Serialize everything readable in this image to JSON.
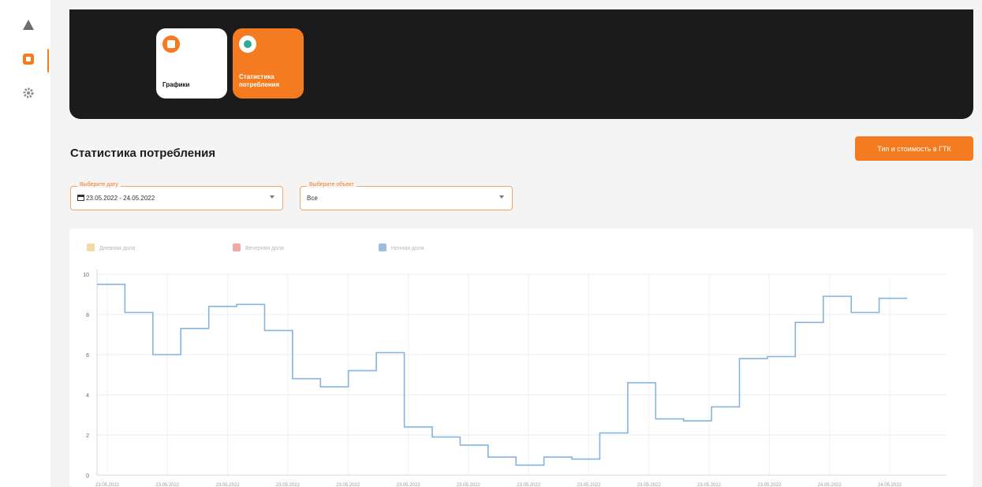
{
  "sidebar": {
    "items": [
      {
        "icon": "warning-triangle-icon",
        "active": false
      },
      {
        "icon": "chart-square-icon",
        "active": true
      },
      {
        "icon": "gear-icon",
        "active": false
      }
    ]
  },
  "hero": {
    "cards": [
      {
        "label": "Графики",
        "active": false
      },
      {
        "label": "Статистика потребления",
        "active": true
      }
    ]
  },
  "page": {
    "title": "Статистика потребления",
    "tariff_button": "Тип и стоимость в ГТК"
  },
  "filters": {
    "date": {
      "label": "Выберите дату",
      "value": "23.05.2022 - 24.05.2022"
    },
    "object": {
      "label": "Выберите объект",
      "value": "Все"
    }
  },
  "colors": {
    "accent": "#f47b20",
    "hero_bg": "#1b1b1b",
    "series_line": "#86b4dd"
  },
  "chart_data": {
    "type": "line",
    "step": true,
    "legend": [
      {
        "name": "Дневная доля",
        "color": "#f3d9a4"
      },
      {
        "name": "Вечерняя доля",
        "color": "#efa9a0"
      },
      {
        "name": "Ночная доля",
        "color": "#9fbde2"
      }
    ],
    "legend_position": "top-left",
    "grid": true,
    "ylim": [
      0,
      10
    ],
    "yticks": [
      0,
      2,
      4,
      6,
      8,
      10
    ],
    "xticks": [
      "23.05.2022",
      "23.05.2022",
      "23.05.2022",
      "23.05.2022",
      "23.05.2022",
      "23.05.2022",
      "23.05.2022",
      "23.05.2022",
      "23.05.2022",
      "23.05.2022",
      "23.05.2022",
      "23.05.2022",
      "24.05.2022",
      "24.05.2022"
    ],
    "series": [
      {
        "values": [
          9.5,
          8.1,
          6.0,
          7.3,
          8.4,
          8.5,
          7.2,
          4.8,
          4.4,
          5.2,
          6.1,
          2.4,
          1.9,
          1.5,
          0.9,
          0.5,
          0.9,
          0.8,
          2.1,
          4.6,
          2.8,
          2.7,
          3.4,
          5.8,
          5.9,
          7.6,
          8.9,
          8.1,
          8.8
        ]
      }
    ]
  }
}
